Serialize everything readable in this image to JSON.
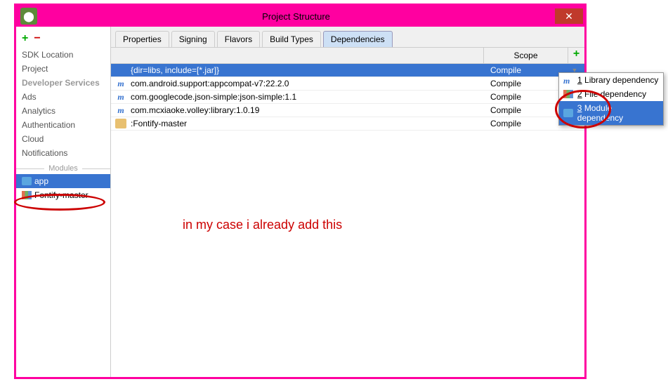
{
  "window": {
    "title": "Project Structure"
  },
  "sidebar": {
    "items": [
      {
        "label": "SDK Location"
      },
      {
        "label": "Project"
      }
    ],
    "services_header": "Developer Services",
    "services": [
      {
        "label": "Ads"
      },
      {
        "label": "Analytics"
      },
      {
        "label": "Authentication"
      },
      {
        "label": "Cloud"
      },
      {
        "label": "Notifications"
      }
    ],
    "modules_header": "Modules",
    "modules": [
      {
        "label": "app",
        "selected": true
      },
      {
        "label": "Fontify-master",
        "selected": false
      }
    ]
  },
  "tabs": [
    {
      "label": "Properties"
    },
    {
      "label": "Signing"
    },
    {
      "label": "Flavors"
    },
    {
      "label": "Build Types"
    },
    {
      "label": "Dependencies",
      "active": true
    }
  ],
  "deps": {
    "scope_header": "Scope",
    "rows": [
      {
        "icon": "",
        "name": "{dir=libs, include=[*.jar]}",
        "scope": "Compile",
        "selected": true
      },
      {
        "icon": "m",
        "name": "com.android.support:appcompat-v7:22.2.0",
        "scope": "Compile"
      },
      {
        "icon": "m",
        "name": "com.googlecode.json-simple:json-simple:1.1",
        "scope": "Compile"
      },
      {
        "icon": "m",
        "name": "com.mcxiaoke.volley:library:1.0.19",
        "scope": "Compile"
      },
      {
        "icon": "folder",
        "name": ":Fontify-master",
        "scope": "Compile"
      }
    ]
  },
  "popup": {
    "items": [
      {
        "num": "1",
        "label": "Library dependency"
      },
      {
        "num": "2",
        "label": "File dependency"
      },
      {
        "num": "3",
        "label": "Module dependency",
        "selected": true
      }
    ]
  },
  "annotation": "in my case i already add this"
}
